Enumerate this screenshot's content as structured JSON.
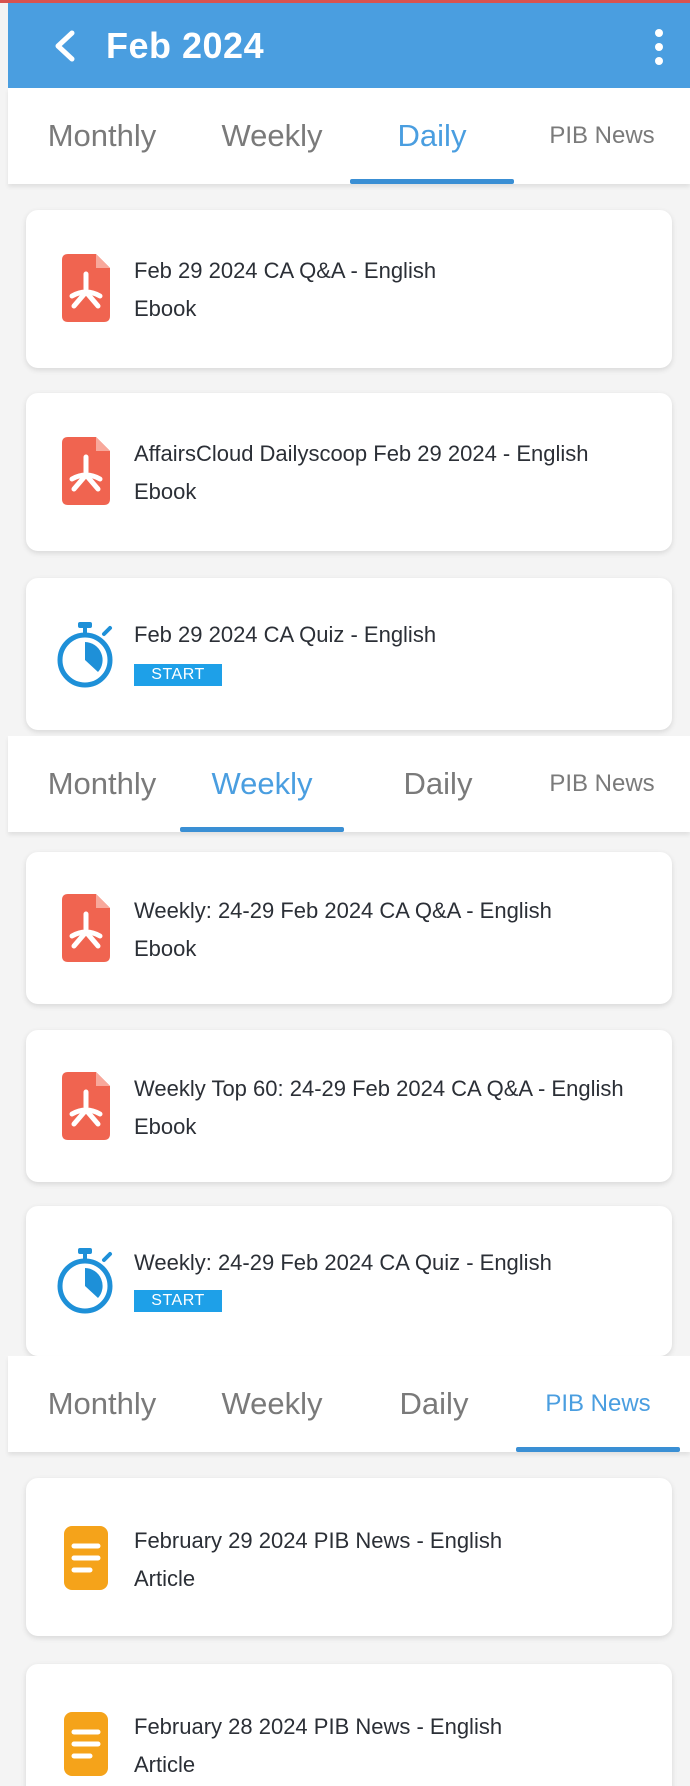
{
  "app": {
    "title": "Feb 2024"
  },
  "tabs": [
    "Monthly",
    "Weekly",
    "Daily",
    "PIB News"
  ],
  "colors": {
    "app_bar": "#4a9ee0",
    "accent": "#3a8fd4",
    "pdf_red": "#f06450",
    "timer_blue": "#1e90d8",
    "article_orange": "#f5a31a",
    "start_button": "#1ea0e8"
  },
  "daily": {
    "active_tab": "Daily",
    "items": [
      {
        "title": "Feb 29 2024 CA Q&A - English",
        "subtitle": "Ebook",
        "icon": "pdf-icon"
      },
      {
        "title": "AffairsCloud Dailyscoop Feb 29 2024 - English",
        "subtitle": "Ebook",
        "icon": "pdf-icon"
      },
      {
        "title": "Feb 29 2024 CA Quiz - English",
        "action": "START",
        "icon": "stopwatch-icon"
      }
    ]
  },
  "weekly": {
    "active_tab": "Weekly",
    "items": [
      {
        "title": "Weekly: 24-29 Feb 2024 CA Q&A - English",
        "subtitle": "Ebook",
        "icon": "pdf-icon"
      },
      {
        "title": "Weekly Top 60: 24-29 Feb 2024 CA Q&A - English",
        "subtitle": "Ebook",
        "icon": "pdf-icon"
      },
      {
        "title": "Weekly: 24-29 Feb 2024 CA Quiz - English",
        "action": "START",
        "icon": "stopwatch-icon"
      }
    ]
  },
  "pib": {
    "active_tab": "PIB News",
    "items": [
      {
        "title": "February 29 2024 PIB News -  English",
        "subtitle": "Article",
        "icon": "article-icon"
      },
      {
        "title": "February 28 2024 PIB News -  English",
        "subtitle": "Article",
        "icon": "article-icon"
      }
    ]
  }
}
